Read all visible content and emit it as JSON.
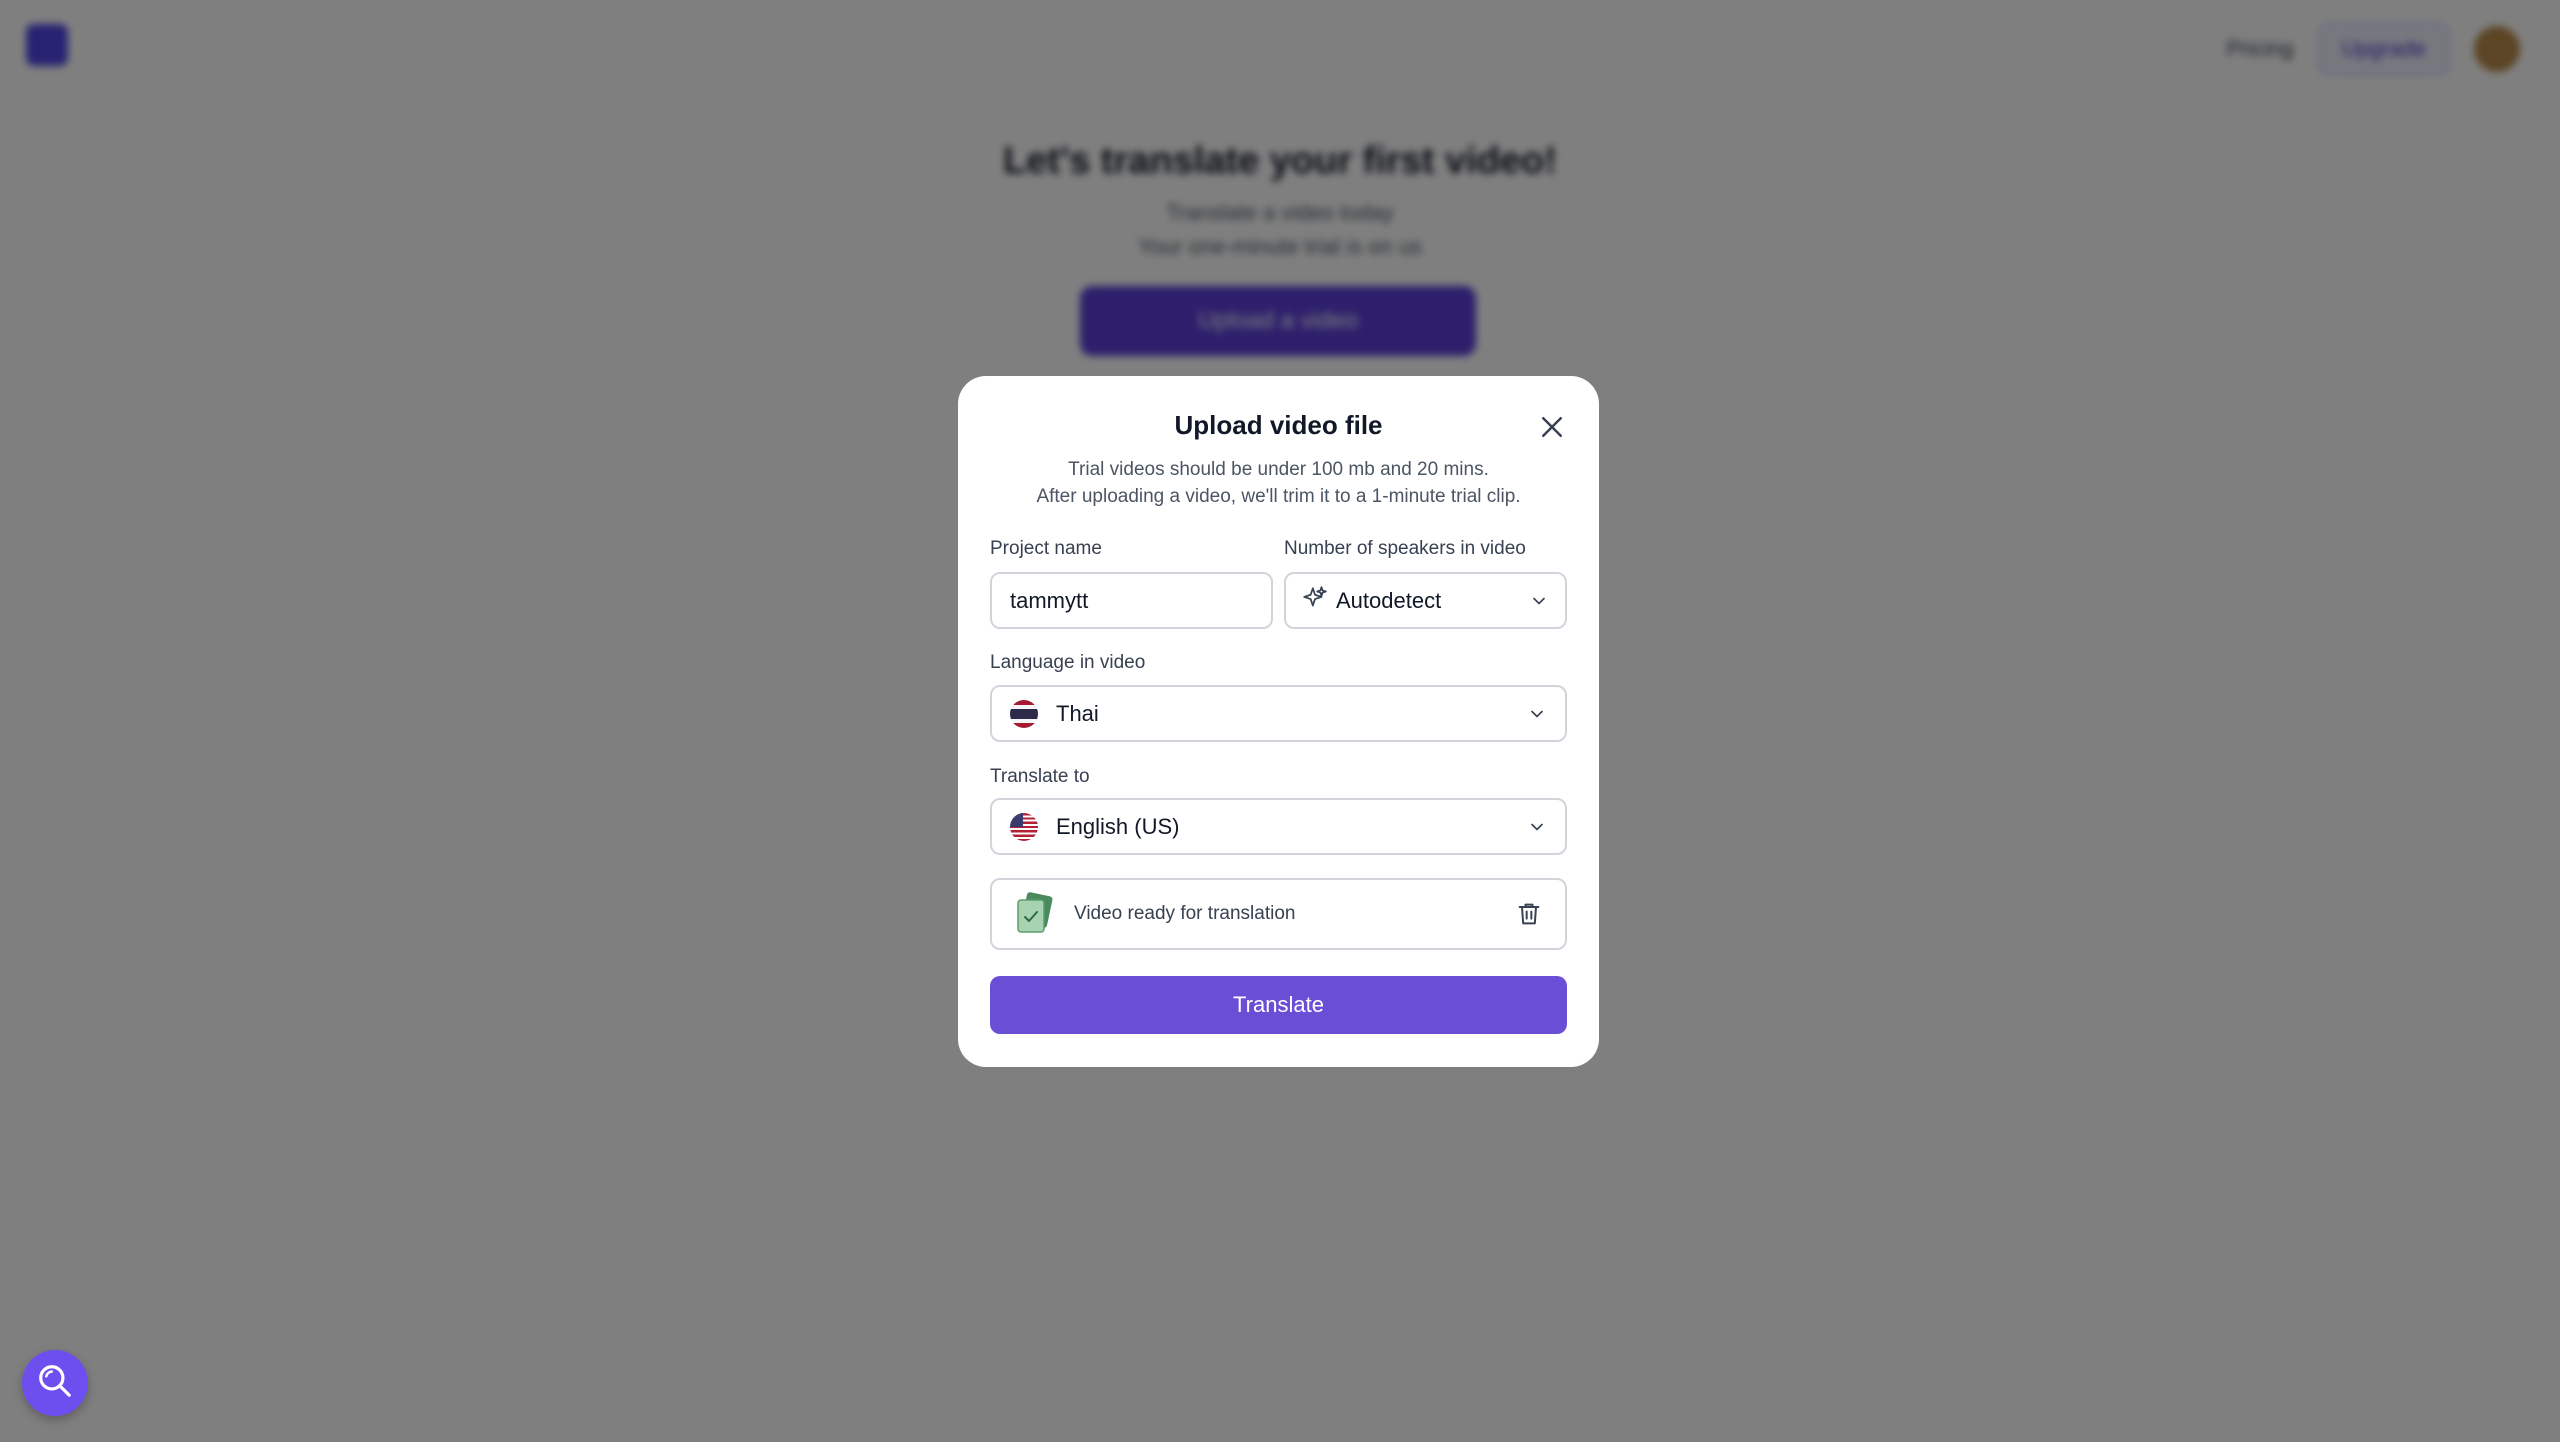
{
  "background": {
    "nav": {
      "link_label": "Pricing",
      "upgrade_label": "Upgrade"
    },
    "hero": {
      "title": "Let's translate your first video!",
      "sub_line1": "Translate a video today",
      "sub_line2": "Your one-minute trial is on us",
      "button_label": "Upload a video"
    }
  },
  "modal": {
    "title": "Upload video file",
    "subtitle_line1": "Trial videos should be under 100 mb and 20 mins.",
    "subtitle_line2": "After uploading a video, we'll trim it to a 1-minute trial clip.",
    "project_name": {
      "label": "Project name",
      "value": "tammytt"
    },
    "speakers": {
      "label": "Number of speakers in video",
      "value": "Autodetect",
      "icon": "sparkle-icon"
    },
    "language": {
      "label": "Language in video",
      "value": "Thai",
      "icon": "thailand-flag-icon"
    },
    "translate_to": {
      "label": "Translate to",
      "value": "English (US)",
      "icon": "us-flag-icon"
    },
    "video_status": {
      "text": "Video ready for translation",
      "icon": "video-check-icon",
      "delete_icon": "trash-icon"
    },
    "translate_button": "Translate"
  },
  "help_widget": {
    "icon": "search-icon"
  },
  "colors": {
    "accent": "#6a4fd6",
    "help_button": "#6d4ff0",
    "overlay": "rgba(0,0,0,0.5)"
  }
}
